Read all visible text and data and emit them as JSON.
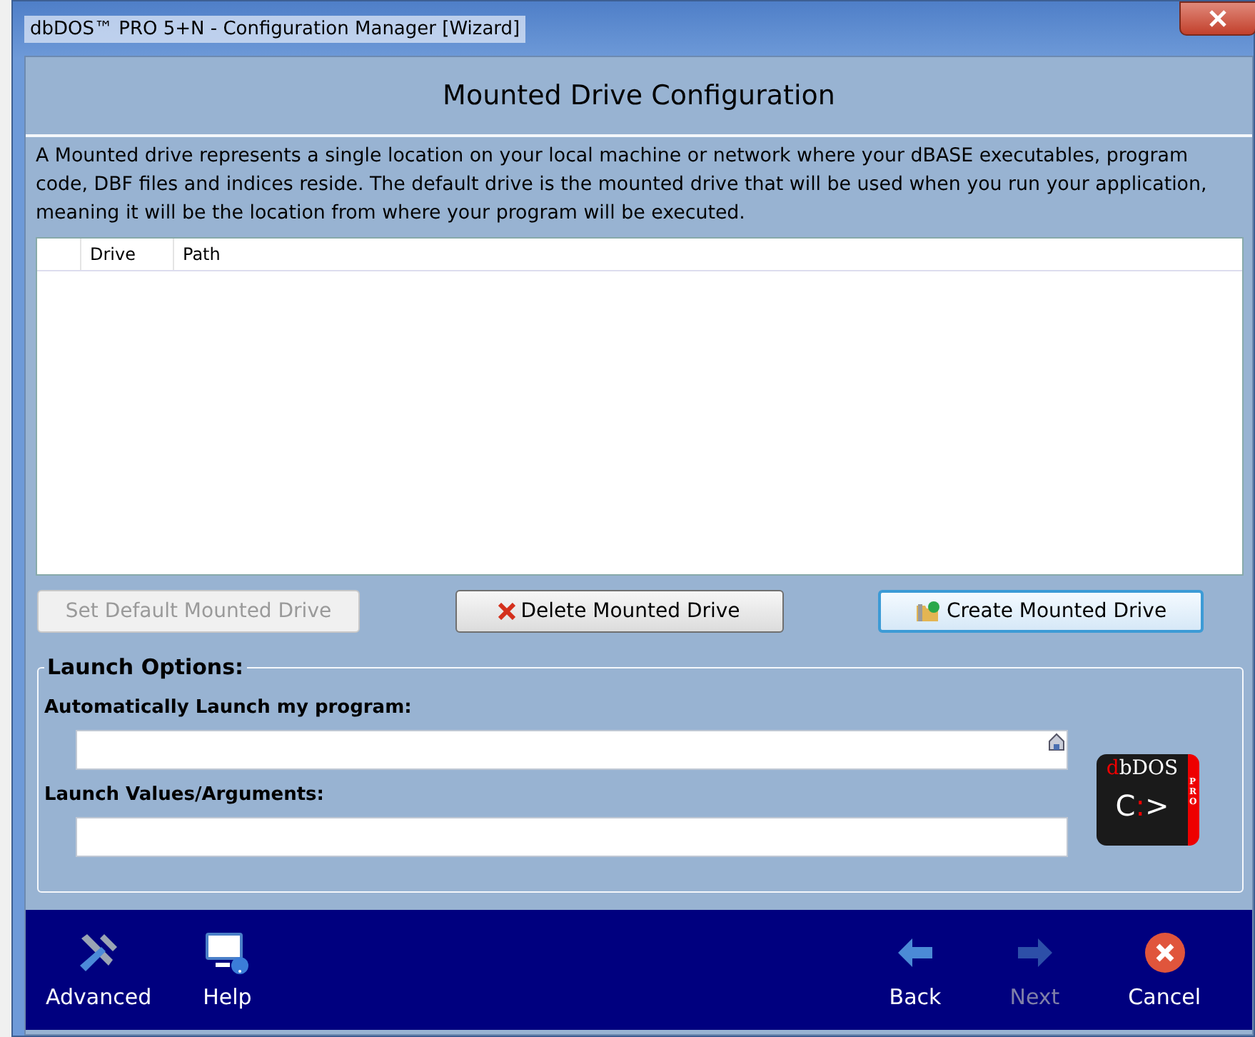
{
  "window": {
    "title": "dbDOS™ PRO 5+N - Configuration Manager [Wizard]"
  },
  "header": {
    "title": "Mounted Drive Configuration"
  },
  "description": "A Mounted drive represents a single location on your local machine or network where your dBASE executables, program code, DBF files and indices reside. The default drive is the mounted drive that will be used when you run your application, meaning it will be the location from where your program will be executed.",
  "table": {
    "columns": [
      "Drive",
      "Path"
    ]
  },
  "actions": [
    {
      "kind": "plain",
      "label": "Set Default Mounted Drive",
      "disabled": true,
      "focused": false
    },
    {
      "kind": "delete",
      "label": "Delete Mounted Drive",
      "disabled": false,
      "focused": false
    },
    {
      "kind": "create",
      "label": "Create Mounted Drive",
      "disabled": false,
      "focused": true
    }
  ],
  "launch_options": {
    "title": "Launch Options:",
    "program_label": "Automatically Launch my program:",
    "arguments_label": "Launch Values/Arguments:"
  },
  "logo": {
    "initial": "d",
    "rest": "bDOS",
    "prompt_drive": "C",
    "prompt_colon": ":",
    "prompt_arrow": ">",
    "badge": "PRO"
  },
  "footer": [
    {
      "kind": "advanced",
      "label": "Advanced",
      "disabled": false
    },
    {
      "kind": "help",
      "label": "Help",
      "disabled": false
    },
    {
      "kind": "back",
      "label": "Back",
      "disabled": false
    },
    {
      "kind": "next",
      "label": "Next",
      "disabled": true
    },
    {
      "kind": "cancel",
      "label": "Cancel",
      "disabled": false
    }
  ]
}
